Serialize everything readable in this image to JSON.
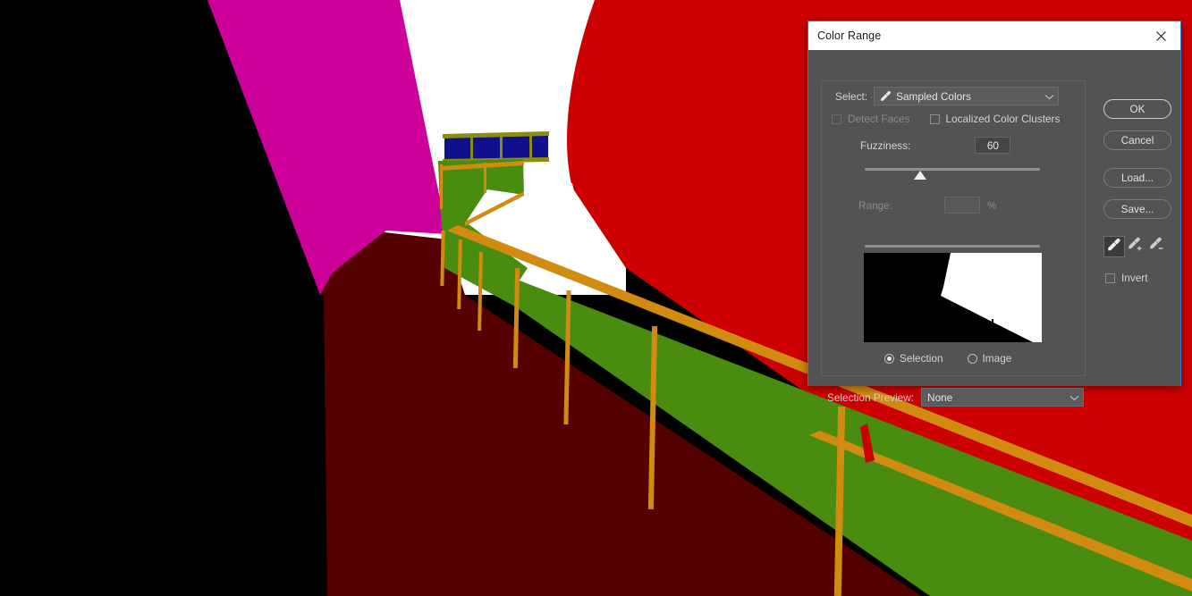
{
  "app": {
    "canvas_artwork": {
      "description": "photoshop-canvas-3d-render",
      "colors": {
        "background_black": "#000000",
        "magenta_wall": "#cc0099",
        "white_sky": "#ffffff",
        "red_wall": "#cc0000",
        "dark_red_ground": "#550000",
        "green_bridge": "#4a8c0f",
        "orange_railing": "#d18b10",
        "navy_panel": "#10108c",
        "olive_frame": "#8c8c10"
      }
    }
  },
  "dialog": {
    "title": "Color Range",
    "close_icon": "close-icon",
    "select": {
      "label": "Select:",
      "value": "Sampled Colors",
      "icon": "eyedropper-icon",
      "chevron": "chevron-down-icon"
    },
    "detect_faces": {
      "label": "Detect Faces",
      "checked": false,
      "enabled": false
    },
    "localized_color_clusters": {
      "label": "Localized Color Clusters",
      "checked": false,
      "enabled": true
    },
    "fuzziness": {
      "label": "Fuzziness:",
      "value": "60",
      "slider_percent": 30
    },
    "range": {
      "label": "Range:",
      "value": "",
      "unit": "%",
      "enabled": false
    },
    "preview_mode": {
      "selection_label": "Selection",
      "image_label": "Image",
      "selected": "Selection"
    },
    "selection_preview": {
      "label": "Selection Preview:",
      "value": "None",
      "chevron": "chevron-down-icon"
    },
    "buttons": {
      "ok": "OK",
      "cancel": "Cancel",
      "load": "Load...",
      "save": "Save..."
    },
    "eyedroppers": {
      "sample": "eyedropper-icon",
      "add": "eyedropper-plus-icon",
      "subtract": "eyedropper-minus-icon",
      "active": "sample"
    },
    "invert": {
      "label": "Invert",
      "checked": false
    },
    "accent_color": "#2a7fd4",
    "panel_color": "#535353"
  }
}
